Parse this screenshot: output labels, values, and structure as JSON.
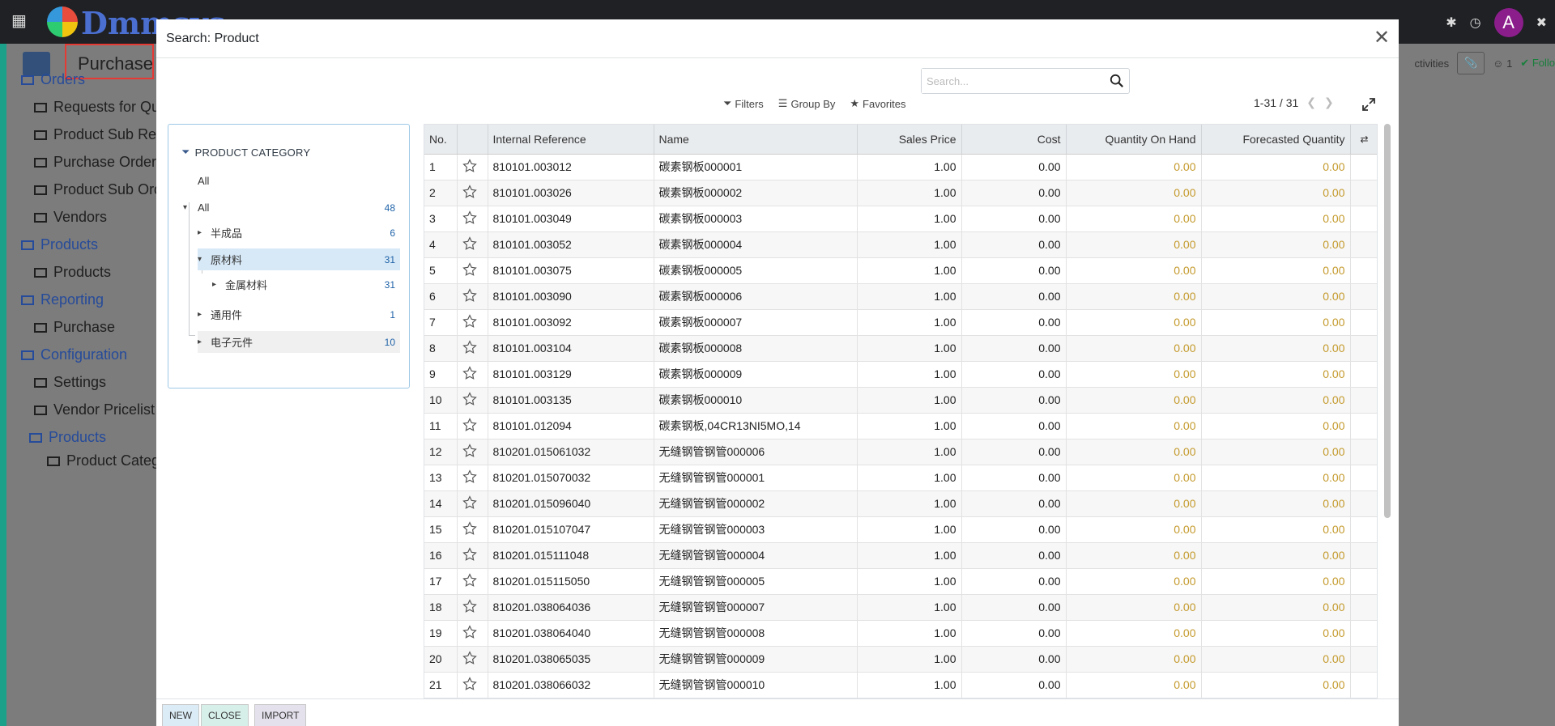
{
  "background": {
    "brand": "Dmmsys",
    "module_title": "Purchase",
    "user_initial": "A",
    "top_right": {
      "activities_label": "ctivities",
      "attachments_count": "1",
      "follow_label": "Follo"
    },
    "menu": [
      {
        "label": "Orders",
        "header": true
      },
      {
        "label": "Requests for Qu",
        "header": false
      },
      {
        "label": "Product Sub Rec",
        "header": false
      },
      {
        "label": "Purchase Orders",
        "header": false
      },
      {
        "label": "Product Sub Ord",
        "header": false
      },
      {
        "label": "Vendors",
        "header": false
      },
      {
        "label": "Products",
        "header": true
      },
      {
        "label": "Products",
        "header": false
      },
      {
        "label": "Reporting",
        "header": true
      },
      {
        "label": "Purchase",
        "header": false
      },
      {
        "label": "Configuration",
        "header": true
      },
      {
        "label": "Settings",
        "header": false
      },
      {
        "label": "Vendor Pricelist",
        "header": false
      },
      {
        "label": "Products",
        "header": true
      },
      {
        "label": "Product Categ",
        "header": false
      }
    ]
  },
  "modal": {
    "title": "Search: Product",
    "search": {
      "placeholder": "Search..."
    },
    "filters_label": "Filters",
    "groupby_label": "Group By",
    "favorites_label": "Favorites",
    "pager": "1-31 / 31"
  },
  "category_panel": {
    "heading": "PRODUCT CATEGORY",
    "items": [
      {
        "label": "All",
        "count": ""
      },
      {
        "label": "All",
        "count": "48"
      },
      {
        "label": "半成品",
        "count": "6"
      },
      {
        "label": "原材料",
        "count": "31"
      },
      {
        "label": "金属材料",
        "count": "31"
      },
      {
        "label": "通用件",
        "count": "1"
      },
      {
        "label": "电子元件",
        "count": "10"
      }
    ]
  },
  "table": {
    "columns": [
      "No.",
      "",
      "Internal Reference",
      "Name",
      "Sales Price",
      "Cost",
      "Quantity On Hand",
      "Forecasted Quantity"
    ],
    "rows": [
      [
        "1",
        "810101.003012",
        "碳素钢板000001",
        "1.00",
        "0.00",
        "0.00",
        "0.00"
      ],
      [
        "2",
        "810101.003026",
        "碳素钢板000002",
        "1.00",
        "0.00",
        "0.00",
        "0.00"
      ],
      [
        "3",
        "810101.003049",
        "碳素钢板000003",
        "1.00",
        "0.00",
        "0.00",
        "0.00"
      ],
      [
        "4",
        "810101.003052",
        "碳素钢板000004",
        "1.00",
        "0.00",
        "0.00",
        "0.00"
      ],
      [
        "5",
        "810101.003075",
        "碳素钢板000005",
        "1.00",
        "0.00",
        "0.00",
        "0.00"
      ],
      [
        "6",
        "810101.003090",
        "碳素钢板000006",
        "1.00",
        "0.00",
        "0.00",
        "0.00"
      ],
      [
        "7",
        "810101.003092",
        "碳素钢板000007",
        "1.00",
        "0.00",
        "0.00",
        "0.00"
      ],
      [
        "8",
        "810101.003104",
        "碳素钢板000008",
        "1.00",
        "0.00",
        "0.00",
        "0.00"
      ],
      [
        "9",
        "810101.003129",
        "碳素钢板000009",
        "1.00",
        "0.00",
        "0.00",
        "0.00"
      ],
      [
        "10",
        "810101.003135",
        "碳素钢板000010",
        "1.00",
        "0.00",
        "0.00",
        "0.00"
      ],
      [
        "11",
        "810101.012094",
        "碳素钢板,04CR13NI5MO,14",
        "1.00",
        "0.00",
        "0.00",
        "0.00"
      ],
      [
        "12",
        "810201.015061032",
        "无缝钢管钢管000006",
        "1.00",
        "0.00",
        "0.00",
        "0.00"
      ],
      [
        "13",
        "810201.015070032",
        "无缝钢管钢管000001",
        "1.00",
        "0.00",
        "0.00",
        "0.00"
      ],
      [
        "14",
        "810201.015096040",
        "无缝钢管钢管000002",
        "1.00",
        "0.00",
        "0.00",
        "0.00"
      ],
      [
        "15",
        "810201.015107047",
        "无缝钢管钢管000003",
        "1.00",
        "0.00",
        "0.00",
        "0.00"
      ],
      [
        "16",
        "810201.015111048",
        "无缝钢管钢管000004",
        "1.00",
        "0.00",
        "0.00",
        "0.00"
      ],
      [
        "17",
        "810201.015115050",
        "无缝钢管钢管000005",
        "1.00",
        "0.00",
        "0.00",
        "0.00"
      ],
      [
        "18",
        "810201.038064036",
        "无缝钢管钢管000007",
        "1.00",
        "0.00",
        "0.00",
        "0.00"
      ],
      [
        "19",
        "810201.038064040",
        "无缝钢管钢管000008",
        "1.00",
        "0.00",
        "0.00",
        "0.00"
      ],
      [
        "20",
        "810201.038065035",
        "无缝钢管钢管000009",
        "1.00",
        "0.00",
        "0.00",
        "0.00"
      ],
      [
        "21",
        "810201.038066032",
        "无缝钢管钢管000010",
        "1.00",
        "0.00",
        "0.00",
        "0.00"
      ]
    ]
  },
  "footer": {
    "new_label": "NEW",
    "close_label": "CLOSE",
    "import_label": "IMPORT"
  },
  "colors": {
    "qty": "#c49a2c",
    "category_active": "#d7e9f7",
    "accent": "#1ba08a"
  }
}
